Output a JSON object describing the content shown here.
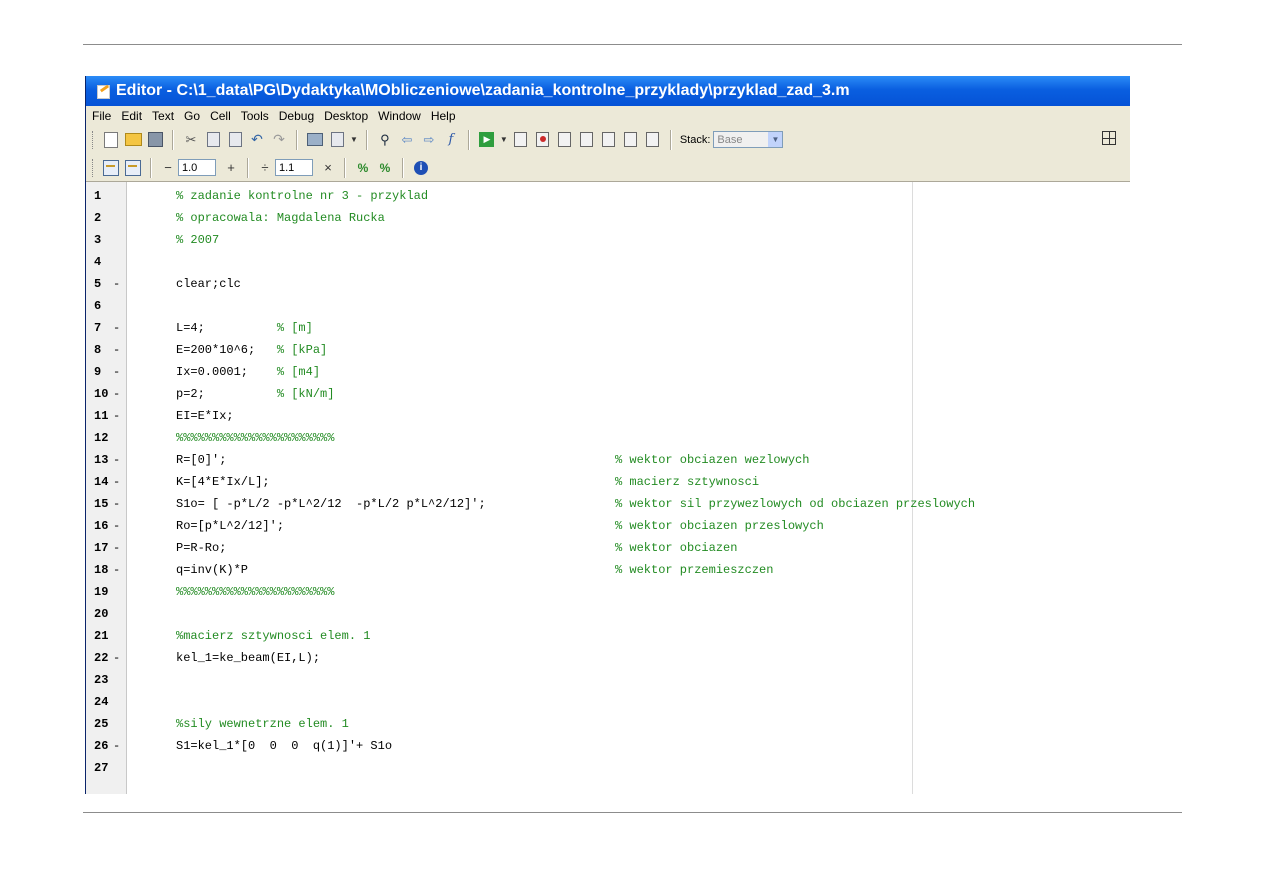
{
  "window": {
    "title": "Editor - C:\\1_data\\PG\\Dydaktyka\\MObliczeniowe\\zadania_kontrolne_przyklady\\przyklad_zad_3.m"
  },
  "menu": [
    "File",
    "Edit",
    "Text",
    "Go",
    "Cell",
    "Tools",
    "Debug",
    "Desktop",
    "Window",
    "Help"
  ],
  "toolbar": {
    "stack_label": "Stack:",
    "stack_value": "Base",
    "decrement_symbol": "−",
    "increment_symbol": "+",
    "divide_symbol": "÷",
    "multiply_symbol": "×",
    "step_value": "1.0",
    "scale_value": "1.1"
  },
  "editor": {
    "lines": [
      {
        "n": "1",
        "dash": "",
        "code": "% zadanie kontrolne nr 3 - przyklad",
        "type": "comment",
        "comment": ""
      },
      {
        "n": "2",
        "dash": "",
        "code": "% opracowala: Magdalena Rucka",
        "type": "comment",
        "comment": ""
      },
      {
        "n": "3",
        "dash": "",
        "code": "% 2007",
        "type": "comment",
        "comment": ""
      },
      {
        "n": "4",
        "dash": "",
        "code": "",
        "type": "code",
        "comment": ""
      },
      {
        "n": "5",
        "dash": "-",
        "code": "clear;clc",
        "type": "code",
        "comment": ""
      },
      {
        "n": "6",
        "dash": "",
        "code": "",
        "type": "code",
        "comment": ""
      },
      {
        "n": "7",
        "dash": "-",
        "code": "L=4;          % [m]",
        "type": "code",
        "comment": ""
      },
      {
        "n": "8",
        "dash": "-",
        "code": "E=200*10^6;   % [kPa]",
        "type": "code",
        "comment": ""
      },
      {
        "n": "9",
        "dash": "-",
        "code": "Ix=0.0001;    % [m4]",
        "type": "code",
        "comment": ""
      },
      {
        "n": "10",
        "dash": "-",
        "code": "p=2;          % [kN/m]",
        "type": "code",
        "comment": ""
      },
      {
        "n": "11",
        "dash": "-",
        "code": "EI=E*Ix;",
        "type": "code",
        "comment": ""
      },
      {
        "n": "12",
        "dash": "",
        "code": "%%%%%%%%%%%%%%%%%%%%%%",
        "type": "comment",
        "comment": ""
      },
      {
        "n": "13",
        "dash": "-",
        "code": "R=[0]';",
        "type": "code",
        "comment": "% wektor obciazen wezlowych"
      },
      {
        "n": "14",
        "dash": "-",
        "code": "K=[4*E*Ix/L];",
        "type": "code",
        "comment": "% macierz sztywnosci"
      },
      {
        "n": "15",
        "dash": "-",
        "code": "S1o= [ -p*L/2 -p*L^2/12  -p*L/2 p*L^2/12]';",
        "type": "code",
        "comment": "% wektor sil przywezlowych od obciazen przeslowych"
      },
      {
        "n": "16",
        "dash": "-",
        "code": "Ro=[p*L^2/12]';",
        "type": "code",
        "comment": "% wektor obciazen przeslowych"
      },
      {
        "n": "17",
        "dash": "-",
        "code": "P=R-Ro;",
        "type": "code",
        "comment": "% wektor obciazen"
      },
      {
        "n": "18",
        "dash": "-",
        "code": "q=inv(K)*P",
        "type": "code",
        "comment": "% wektor przemieszczen"
      },
      {
        "n": "19",
        "dash": "",
        "code": "%%%%%%%%%%%%%%%%%%%%%%",
        "type": "comment",
        "comment": ""
      },
      {
        "n": "20",
        "dash": "",
        "code": "",
        "type": "code",
        "comment": ""
      },
      {
        "n": "21",
        "dash": "",
        "code": "%macierz sztywnosci elem. 1",
        "type": "comment",
        "comment": ""
      },
      {
        "n": "22",
        "dash": "-",
        "code": "kel_1=ke_beam(EI,L);",
        "type": "code",
        "comment": ""
      },
      {
        "n": "23",
        "dash": "",
        "code": "",
        "type": "code",
        "comment": ""
      },
      {
        "n": "24",
        "dash": "",
        "code": "",
        "type": "code",
        "comment": ""
      },
      {
        "n": "25",
        "dash": "",
        "code": "%sily wewnetrzne elem. 1",
        "type": "comment",
        "comment": ""
      },
      {
        "n": "26",
        "dash": "-",
        "code": "S1=kel_1*[0  0  0  q(1)]'+ S1o",
        "type": "code",
        "comment": ""
      },
      {
        "n": "27",
        "dash": "",
        "code": "",
        "type": "code",
        "comment": ""
      }
    ]
  }
}
